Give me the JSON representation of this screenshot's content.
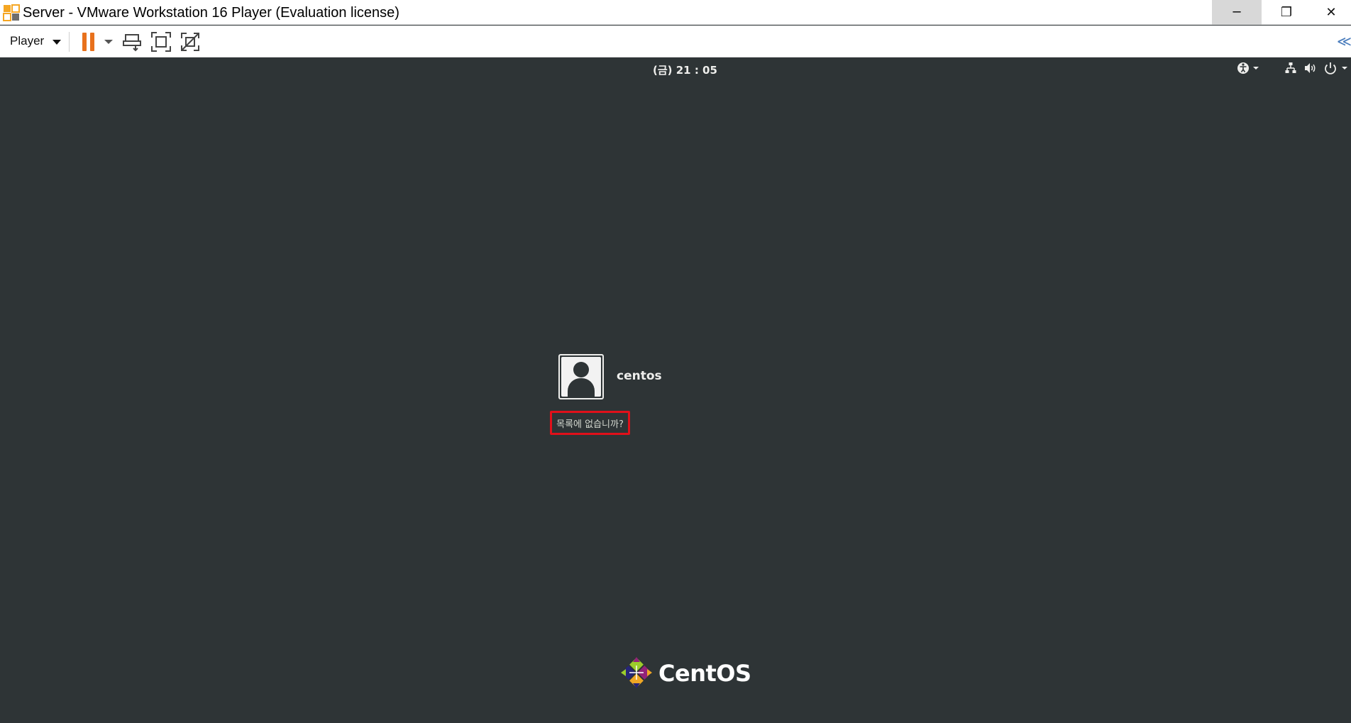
{
  "window": {
    "title": "Server - VMware Workstation 16 Player (Evaluation license)",
    "minimize_glyph": "─",
    "restore_glyph": "❐",
    "close_glyph": "✕"
  },
  "toolbar": {
    "player_menu_label": "Player",
    "collapse_glyph": "≪",
    "icons": [
      "pause-icon",
      "send-ctrl-alt-del-icon",
      "fullscreen-icon",
      "unity-icon"
    ]
  },
  "guest": {
    "clock": "(금) 21 : 05",
    "system_icons": [
      "accessibility-icon",
      "network-icon",
      "volume-icon",
      "power-icon"
    ]
  },
  "login": {
    "user_name": "centos",
    "not_listed_label": "목록에 없습니까?"
  },
  "branding": {
    "logo_text": "CentOS"
  },
  "colors": {
    "guest_background": "#2e3436",
    "accent_pause": "#e8711c",
    "highlight_border": "#e0101a"
  }
}
